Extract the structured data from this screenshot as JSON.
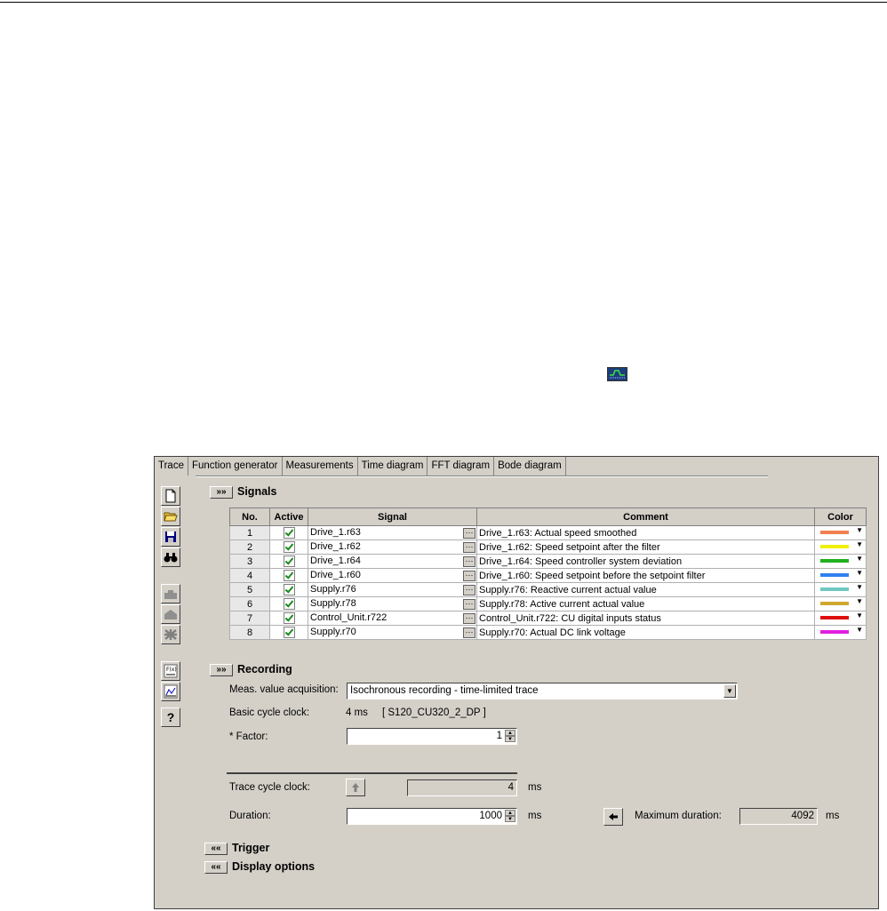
{
  "tabs": [
    "Trace",
    "Function generator",
    "Measurements",
    "Time diagram",
    "FFT diagram",
    "Bode diagram"
  ],
  "toolbar_icons": [
    "new-icon",
    "open-icon",
    "save-icon",
    "find-icon",
    "device-1-icon",
    "device-2-icon",
    "device-3-icon",
    "formula-icon",
    "chart-icon",
    "help-icon"
  ],
  "toolbar_help_label": "?",
  "signals": {
    "expand_label": "»»",
    "title": "Signals",
    "columns": [
      "No.",
      "Active",
      "Signal",
      "Comment",
      "Color"
    ],
    "rows": [
      {
        "no": "1",
        "signal": "Drive_1.r63",
        "comment": "Drive_1.r63: Actual speed smoothed",
        "color": "#f08050"
      },
      {
        "no": "2",
        "signal": "Drive_1.r62",
        "comment": "Drive_1.r62: Speed setpoint after the filter",
        "color": "#f0f000"
      },
      {
        "no": "3",
        "signal": "Drive_1.r64",
        "comment": "Drive_1.r64: Speed controller system deviation",
        "color": "#20b020"
      },
      {
        "no": "4",
        "signal": "Drive_1.r60",
        "comment": "Drive_1.r60: Speed setpoint before the setpoint filter",
        "color": "#3080f0"
      },
      {
        "no": "5",
        "signal": "Supply.r76",
        "comment": "Supply.r76: Reactive current actual value",
        "color": "#70c8c0"
      },
      {
        "no": "6",
        "signal": "Supply.r78",
        "comment": "Supply.r78: Active current actual value",
        "color": "#d0a830"
      },
      {
        "no": "7",
        "signal": "Control_Unit.r722",
        "comment": "Control_Unit.r722: CU digital inputs status",
        "color": "#e01010"
      },
      {
        "no": "8",
        "signal": "Supply.r70",
        "comment": "Supply.r70: Actual DC link voltage",
        "color": "#e020e0"
      }
    ]
  },
  "recording": {
    "expand_label": "»»",
    "title": "Recording",
    "meas_label": "Meas. value acquisition:",
    "meas_value": "Isochronous recording - time-limited trace",
    "basic_cycle_label": "Basic cycle clock:",
    "basic_cycle_value": "4 ms",
    "basic_cycle_device": "[ S120_CU320_2_DP ]",
    "factor_label": "* Factor:",
    "factor_value": "1",
    "trace_cycle_label": "Trace cycle clock:",
    "trace_cycle_value": "4",
    "trace_cycle_unit": "ms",
    "duration_label": "Duration:",
    "duration_value": "1000",
    "duration_unit": "ms",
    "max_duration_label": "Maximum duration:",
    "max_duration_value": "4092",
    "max_duration_unit": "ms"
  },
  "trigger": {
    "collapse_label": "««",
    "title": "Trigger"
  },
  "display_options": {
    "collapse_label": "««",
    "title": "Display options"
  }
}
